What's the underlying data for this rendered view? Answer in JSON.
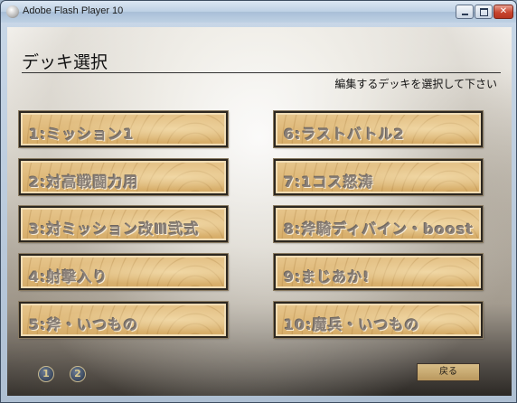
{
  "window": {
    "title": "Adobe Flash Player 10",
    "controls": {
      "minimize": "minimize",
      "maximize": "maximize",
      "close": "✕"
    }
  },
  "screen": {
    "heading": "デッキ選択",
    "instruction": "編集するデッキを選択して下さい"
  },
  "decks": [
    {
      "label": "1:ミッション1"
    },
    {
      "label": "2:対高戦闘力用"
    },
    {
      "label": "3:対ミッション改Ⅲ弐式"
    },
    {
      "label": "4:射撃入り"
    },
    {
      "label": "5:斧・いつもの"
    },
    {
      "label": "6:ラストバトル2"
    },
    {
      "label": "7:1コス怒涛"
    },
    {
      "label": "8:斧騎ディバイン・boost"
    },
    {
      "label": "9:まじあか!"
    },
    {
      "label": "10:魔兵・いつもの"
    }
  ],
  "pagination": {
    "pages": [
      "1",
      "2"
    ]
  },
  "back_button": "戻る",
  "colors": {
    "button_gold": "#d6ac67",
    "button_text": "#8a8078",
    "titlebar": "#bdd0e4"
  }
}
